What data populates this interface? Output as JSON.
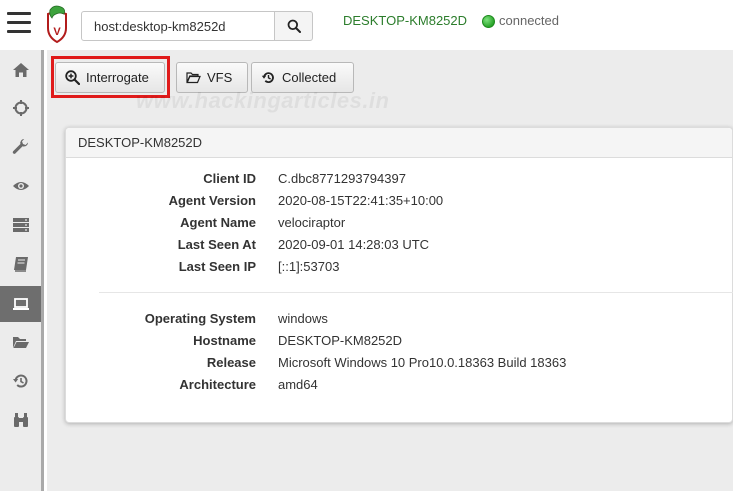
{
  "header": {
    "search_value": "host:desktop-km8252d",
    "hostname": "DESKTOP-KM8252D",
    "status": "connected",
    "status_color": "#2aa52a"
  },
  "sidebar": {
    "items": [
      {
        "name": "home",
        "icon": "home-icon"
      },
      {
        "name": "hunt",
        "icon": "crosshairs-icon"
      },
      {
        "name": "server-artifacts",
        "icon": "wrench-icon"
      },
      {
        "name": "view-artifacts",
        "icon": "eye-icon"
      },
      {
        "name": "server-events",
        "icon": "server-icon"
      },
      {
        "name": "notebooks",
        "icon": "book-icon"
      },
      {
        "name": "clients",
        "icon": "laptop-icon",
        "active": true
      },
      {
        "name": "vfs",
        "icon": "folder-open-icon"
      },
      {
        "name": "history",
        "icon": "history-icon"
      },
      {
        "name": "binoculars",
        "icon": "binoculars-icon"
      }
    ]
  },
  "toolbar": {
    "interrogate_label": "Interrogate",
    "vfs_label": "VFS",
    "collected_label": "Collected"
  },
  "watermark": "www.hackingarticles.in",
  "client": {
    "title": "DESKTOP-KM8252D",
    "fields": [
      {
        "label": "Client ID",
        "value": "C.dbc8771293794397"
      },
      {
        "label": "Agent Version",
        "value": "2020-08-15T22:41:35+10:00"
      },
      {
        "label": "Agent Name",
        "value": "velociraptor"
      },
      {
        "label": "Last Seen At",
        "value": "2020-09-01 14:28:03 UTC"
      },
      {
        "label": "Last Seen IP",
        "value": "[::1]:53703"
      }
    ],
    "os_fields": [
      {
        "label": "Operating System",
        "value": "windows"
      },
      {
        "label": "Hostname",
        "value": "DESKTOP-KM8252D"
      },
      {
        "label": "Release",
        "value": "Microsoft Windows 10 Pro10.0.18363 Build 18363"
      },
      {
        "label": "Architecture",
        "value": "amd64"
      }
    ]
  }
}
